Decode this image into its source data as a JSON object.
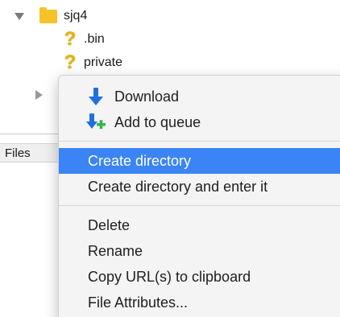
{
  "tree": {
    "root_folder": "sjq4",
    "children": [
      ".bin",
      "private"
    ]
  },
  "files_header": "Files",
  "context_menu": {
    "download": "Download",
    "add_to_queue": "Add to queue",
    "create_directory": "Create directory",
    "create_directory_enter": "Create directory and enter it",
    "delete": "Delete",
    "rename": "Rename",
    "copy_url": "Copy URL(s) to clipboard",
    "file_attributes": "File Attributes..."
  },
  "colors": {
    "highlight": "#3a84f5",
    "folder": "#f6c22a",
    "download_arrow": "#1f6fe0",
    "queue_plus": "#2fb84a"
  },
  "icons": {
    "root_folder": "folder-icon",
    "unknown_file": "question-mark-icon",
    "download": "download-arrow-icon",
    "add_to_queue": "add-to-queue-icon"
  }
}
